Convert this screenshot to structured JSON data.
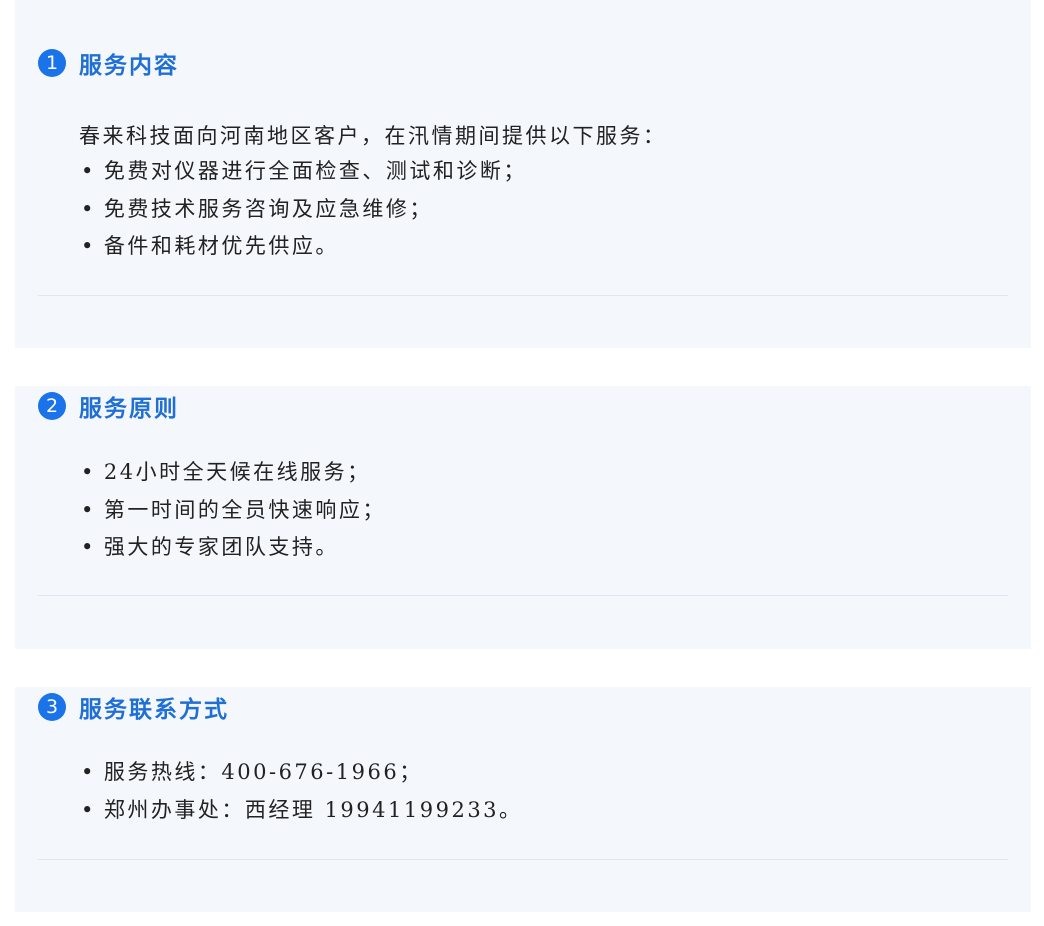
{
  "sections": [
    {
      "number": "1",
      "title": "服务内容",
      "intro": "春来科技面向河南地区客户，在汛情期间提供以下服务：",
      "items": [
        "免费对仪器进行全面检查、测试和诊断；",
        "免费技术服务咨询及应急维修；",
        "备件和耗材优先供应。"
      ]
    },
    {
      "number": "2",
      "title": "服务原则",
      "items": [
        "24小时全天候在线服务；",
        "第一时间的全员快速响应；",
        "强大的专家团队支持。"
      ]
    },
    {
      "number": "3",
      "title": "服务联系方式",
      "items": [
        "服务热线：400-676-1966；",
        "郑州办事处：西经理 19941199233。"
      ]
    }
  ],
  "bullet": "•",
  "colors": {
    "accent": "#1a73e8",
    "title": "#1f6fd4",
    "panel": "#f4f8fd"
  }
}
